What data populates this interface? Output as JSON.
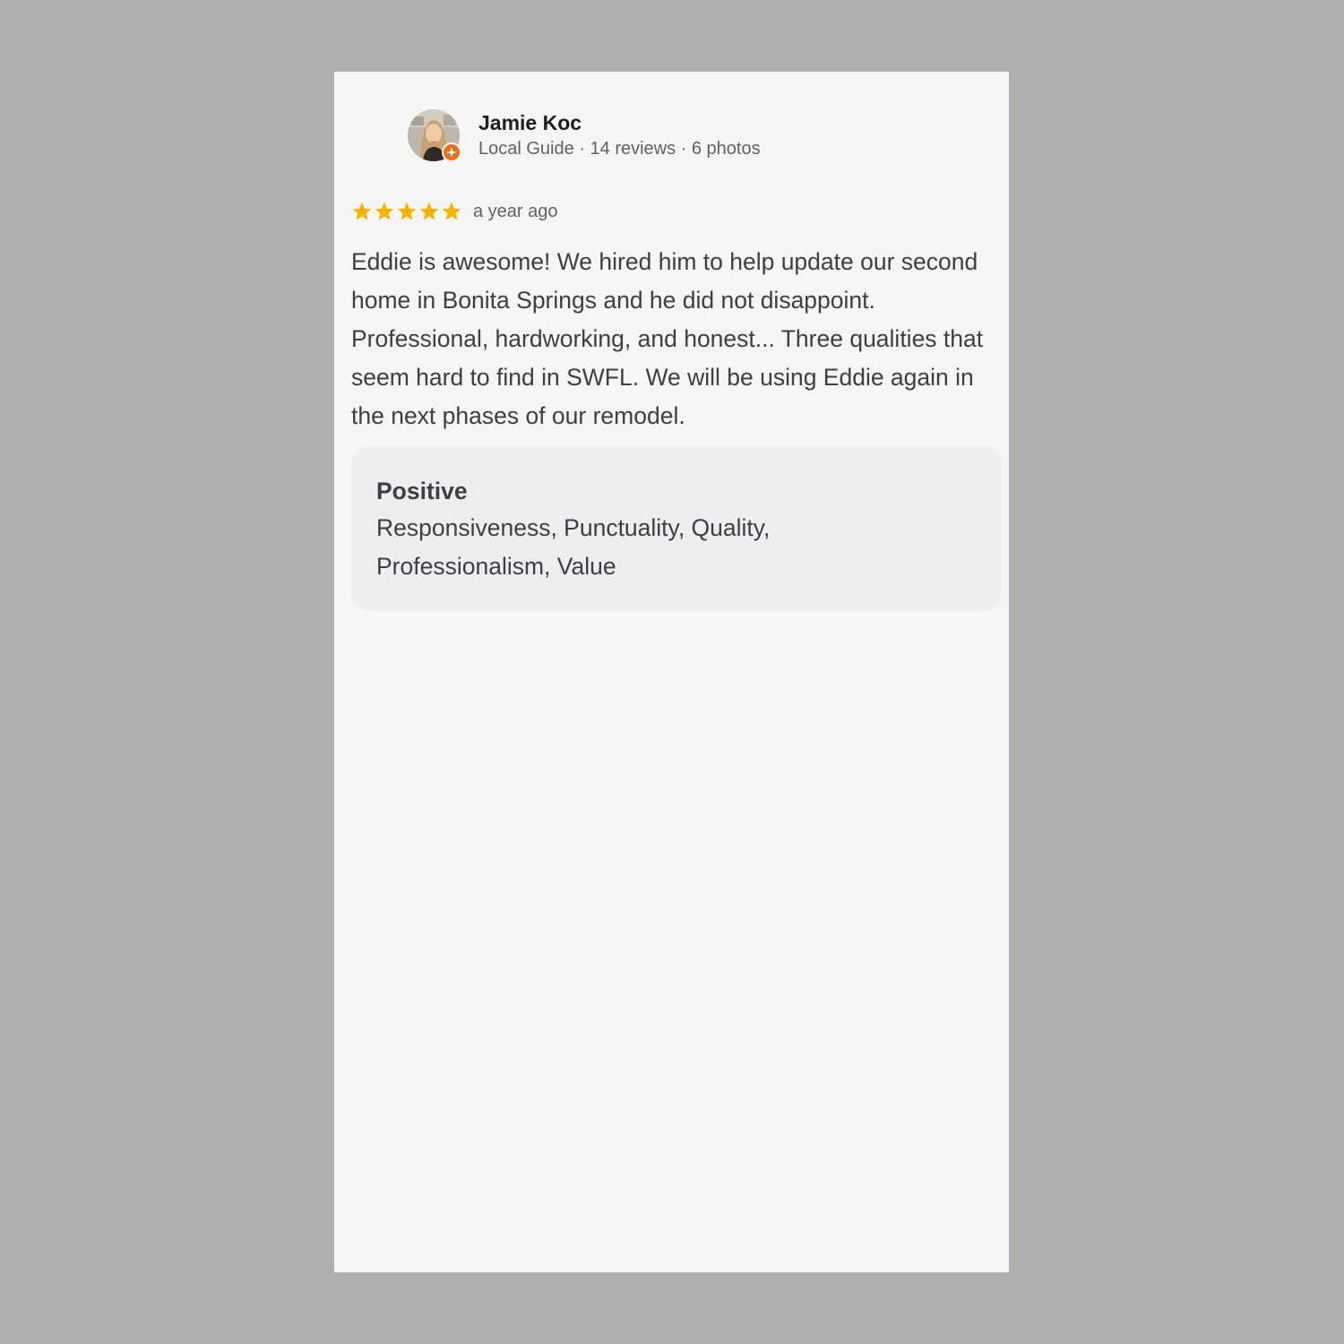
{
  "review": {
    "reviewer": {
      "name": "Jamie Koc",
      "meta": "Local Guide · 14 reviews · 6 photos",
      "avatar_icon": "avatar",
      "badge_icon": "local-guide-badge-icon"
    },
    "rating": {
      "stars": 5,
      "max_stars": 5,
      "star_color": "#f4b400",
      "time": "a year ago"
    },
    "text": "Eddie is awesome! We hired him to help update our second home in Bonita Springs and he did not disappoint. Professional, hardworking, and honest... Three qualities that seem hard to find in SWFL. We will be using Eddie again in the next phases of our remodel.",
    "attributes": {
      "title": "Positive",
      "values": "Responsiveness, Punctuality, Quality, Professionalism, Value"
    }
  },
  "colors": {
    "page_background": "#b0b0ae",
    "card_background": "#f5f5f5",
    "attribute_background": "#edeef0",
    "badge": "#e8711f"
  }
}
